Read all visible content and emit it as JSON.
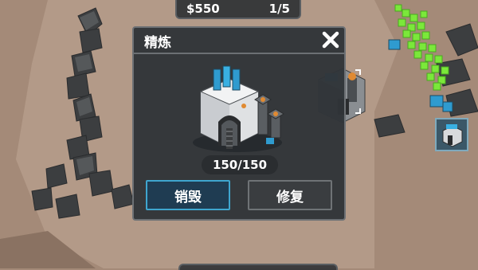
{
  "hud": {
    "money": "$550",
    "count": "1/5"
  },
  "panel": {
    "title": "精炼",
    "health": "150/150",
    "destroy_label": "销毁",
    "repair_label": "修复"
  },
  "icons": {
    "close": "close-icon",
    "building": "refinery-building-icon",
    "unit": "unit-portrait-icon"
  },
  "colors": {
    "accent": "#3fa6cf",
    "panel_bg": "#303438",
    "crystal": "#7be83a",
    "ground": "#a48a78"
  }
}
